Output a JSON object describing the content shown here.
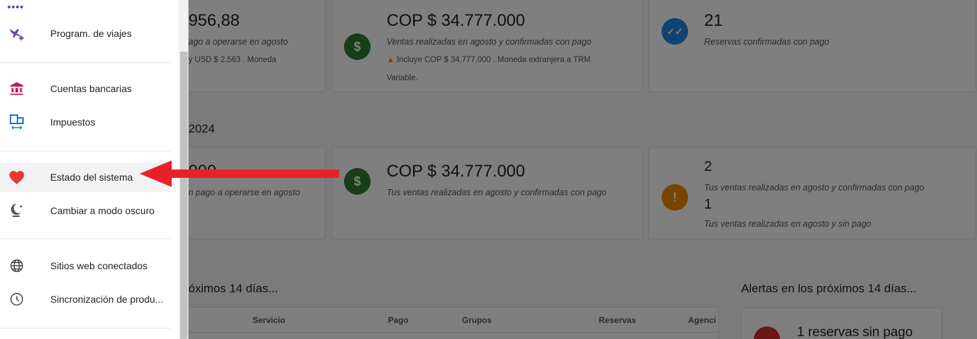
{
  "colors": {
    "green": "#2e7d32",
    "blue": "#1e88e5",
    "orange": "#f08a00",
    "red": "#d32f2f",
    "arrow": "#e8202a",
    "menu_pink": "#c2185b",
    "menu_blue": "#1976d2",
    "menu_purple": "#6a3db8"
  },
  "drawer": {
    "items": [
      {
        "label": "Program. de viajes",
        "icon": "flight-plus-icon"
      },
      {
        "label": "Cuentas bancarias",
        "icon": "bank-icon"
      },
      {
        "label": "Impuestos",
        "icon": "tax-icon"
      },
      {
        "label": "Estado del sistema",
        "icon": "heart-icon"
      },
      {
        "label": "Cambiar a modo oscuro",
        "icon": "dark-mode-icon"
      },
      {
        "label": "Sitios web conectados",
        "icon": "globe-icon"
      },
      {
        "label": "Sincronización de produ...",
        "icon": "clock-icon"
      }
    ]
  },
  "row1": {
    "card1": {
      "value": "956,88",
      "desc": "ago a operarse en agosto",
      "note": "y USD $ 2.563 . Moneda"
    },
    "card2": {
      "value": "COP $ 34.777.000",
      "desc": "Ventas realizadas en agosto y confirmadas con pago",
      "note": "Incluye COP $ 34.777.000 . Moneda extranjera a TRM",
      "note2": "Variable."
    },
    "card3": {
      "value": "21",
      "desc": "Reservas confirmadas con pago"
    }
  },
  "section_year": "2024",
  "row2": {
    "card1": {
      "value": "000",
      "desc": "n pago a operarse en agosto"
    },
    "card2": {
      "value": "COP $ 34.777.000",
      "desc": "Tus ventas realizadas en agosto y confirmadas con pago"
    },
    "card3": {
      "value1": "2",
      "desc1": "Tus ventas realizadas en agosto y confirmadas con pago",
      "value2": "1",
      "desc2": "Tus ventas realizadas en agosto y sin pago"
    }
  },
  "upcoming": {
    "title": "óximos 14 días...",
    "columns": [
      "Servicio",
      "Pago",
      "Grupos",
      "Reservas",
      "Agenci"
    ]
  },
  "alerts": {
    "title": "Alertas en los próximos 14 días...",
    "card_text": "1 reservas sin pago"
  }
}
